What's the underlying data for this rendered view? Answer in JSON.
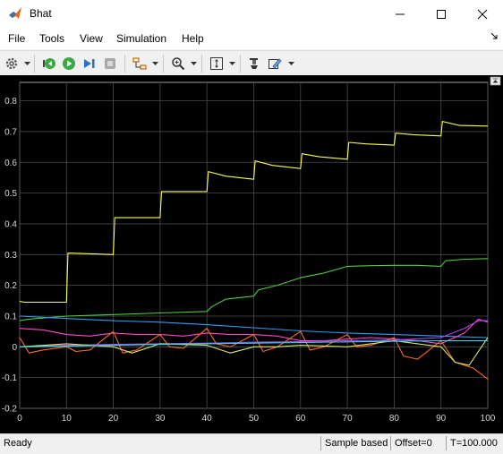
{
  "window": {
    "title": "Bhat",
    "controls": [
      "minimize",
      "maximize",
      "close"
    ]
  },
  "menu": {
    "items": [
      "File",
      "Tools",
      "View",
      "Simulation",
      "Help"
    ]
  },
  "toolbar": {
    "buttons": [
      "settings-icon",
      "step-back-icon",
      "run-icon",
      "step-forward-icon",
      "stop-icon",
      "signal-select-icon",
      "zoom-icon",
      "fit-icon",
      "highlight-icon",
      "style-icon"
    ]
  },
  "chart_data": {
    "type": "line",
    "title": "",
    "xlabel": "",
    "ylabel": "",
    "xlim": [
      0,
      100
    ],
    "ylim": [
      -0.2,
      0.86
    ],
    "x_ticks": [
      "0",
      "10",
      "20",
      "30",
      "40",
      "50",
      "60",
      "70",
      "80",
      "90",
      "100"
    ],
    "y_ticks": [
      "-0.2",
      "-0.1",
      "0",
      "0.1",
      "0.2",
      "0.3",
      "0.4",
      "0.5",
      "0.6",
      "0.7",
      "0.8"
    ],
    "grid": true,
    "series": [
      {
        "color": "#ffff4d",
        "x": [
          0,
          1,
          10,
          10.3,
          20,
          20.3,
          30,
          30.3,
          40,
          40.3,
          44,
          50,
          50.3,
          54,
          60,
          60.3,
          64,
          70,
          70.3,
          74,
          80,
          80.3,
          84,
          90,
          90.3,
          94,
          100
        ],
        "y": [
          0.148,
          0.145,
          0.145,
          0.305,
          0.3,
          0.42,
          0.42,
          0.505,
          0.505,
          0.57,
          0.555,
          0.545,
          0.605,
          0.59,
          0.58,
          0.628,
          0.618,
          0.61,
          0.665,
          0.66,
          0.656,
          0.695,
          0.69,
          0.686,
          0.733,
          0.72,
          0.718
        ]
      },
      {
        "color": "#4fcc3a",
        "x": [
          0,
          2,
          10,
          20,
          30,
          40,
          41,
          44,
          50,
          51,
          55,
          60,
          65,
          70,
          75,
          80,
          85,
          90,
          91,
          95,
          100
        ],
        "y": [
          0.085,
          0.09,
          0.1,
          0.105,
          0.11,
          0.115,
          0.13,
          0.155,
          0.165,
          0.185,
          0.2,
          0.225,
          0.24,
          0.262,
          0.264,
          0.265,
          0.265,
          0.262,
          0.28,
          0.285,
          0.287
        ]
      },
      {
        "color": "#2e9df5",
        "x": [
          0,
          10,
          20,
          30,
          40,
          50,
          60,
          70,
          80,
          90,
          100
        ],
        "y": [
          0.1,
          0.092,
          0.085,
          0.08,
          0.072,
          0.062,
          0.052,
          0.045,
          0.04,
          0.035,
          0.03
        ]
      },
      {
        "color": "#ff48c8",
        "x": [
          0,
          5,
          10,
          15,
          20,
          25,
          30,
          35,
          40,
          45,
          50,
          55,
          60,
          65,
          70,
          75,
          80,
          85,
          90,
          95,
          98,
          100
        ],
        "y": [
          0.06,
          0.055,
          0.04,
          0.035,
          0.045,
          0.04,
          0.04,
          0.035,
          0.045,
          0.04,
          0.04,
          0.035,
          0.02,
          0.02,
          0.025,
          0.03,
          0.025,
          0.02,
          0.01,
          0.045,
          0.09,
          0.08
        ]
      },
      {
        "color": "#ff6a22",
        "x": [
          0,
          2,
          5,
          10,
          12,
          15,
          20,
          22,
          25,
          30,
          32,
          35,
          40,
          42,
          45,
          50,
          52,
          55,
          60,
          62,
          65,
          70,
          72,
          75,
          80,
          82,
          85,
          90,
          93,
          97,
          100
        ],
        "y": [
          0.03,
          -0.02,
          -0.01,
          0.0,
          -0.015,
          -0.01,
          0.05,
          -0.02,
          -0.01,
          0.04,
          0.0,
          -0.005,
          0.06,
          0.01,
          0.0,
          0.04,
          -0.015,
          0.0,
          0.05,
          -0.01,
          0.0,
          0.04,
          0.0,
          0.005,
          0.03,
          -0.03,
          -0.04,
          0.02,
          -0.05,
          -0.07,
          -0.105
        ]
      },
      {
        "color": "#b244ff",
        "x": [
          0,
          10,
          20,
          30,
          40,
          50,
          60,
          70,
          80,
          90,
          95,
          98,
          100
        ],
        "y": [
          0.0,
          0.005,
          0.008,
          0.01,
          0.012,
          0.015,
          0.017,
          0.02,
          0.022,
          0.03,
          0.06,
          0.085,
          0.085
        ]
      },
      {
        "color": "#d4e86a",
        "x": [
          0,
          10,
          20,
          24,
          30,
          40,
          45,
          50,
          55,
          60,
          70,
          80,
          85,
          90,
          93,
          96,
          100
        ],
        "y": [
          0.0,
          0.01,
          0.0,
          -0.02,
          0.01,
          0.005,
          -0.02,
          0.0,
          0.0,
          0.005,
          0.0,
          0.02,
          0.01,
          0.0,
          -0.05,
          -0.06,
          0.03
        ]
      },
      {
        "color": "#33d9e8",
        "x": [
          0,
          10,
          20,
          30,
          40,
          50,
          60,
          70,
          80,
          90,
          100
        ],
        "y": [
          0.0,
          0.002,
          0.005,
          0.008,
          0.01,
          0.012,
          0.014,
          0.016,
          0.018,
          0.02,
          0.02
        ]
      }
    ]
  },
  "status": {
    "ready": "Ready",
    "mode": "Sample based",
    "offset": "Offset=0",
    "time": "T=100.000"
  }
}
